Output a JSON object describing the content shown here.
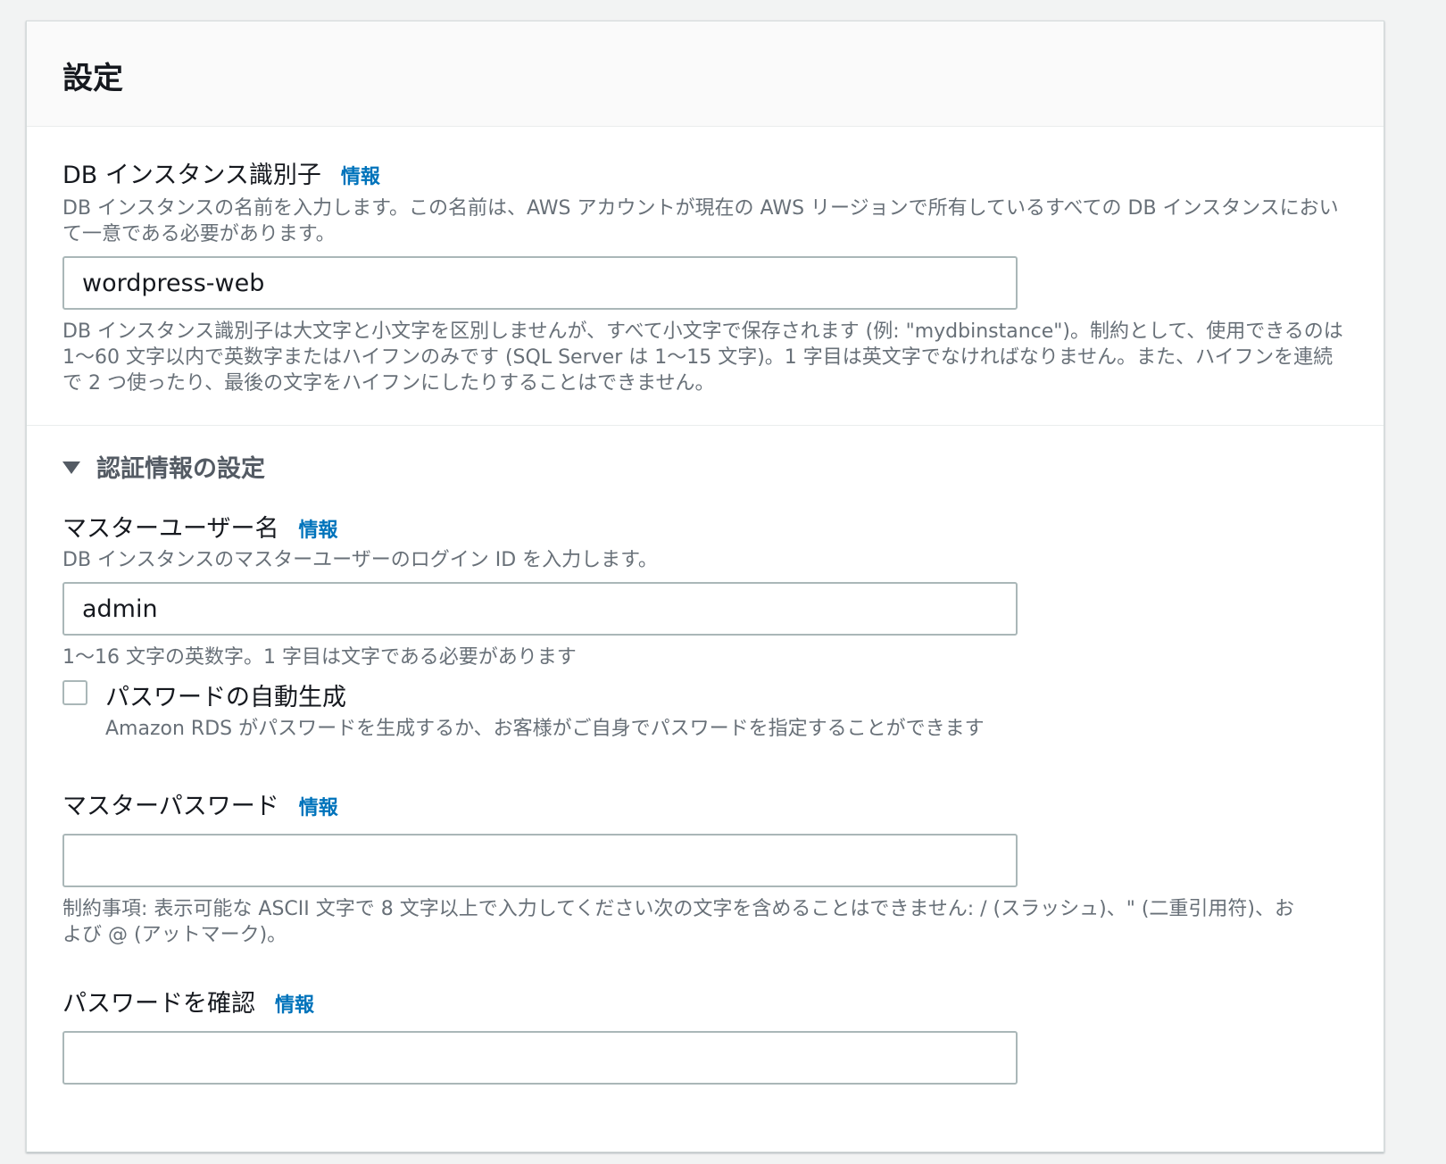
{
  "header": {
    "title": "設定"
  },
  "instance_identifier": {
    "label": "DB インスタンス識別子",
    "info": "情報",
    "description": "DB インスタンスの名前を入力します。この名前は、AWS アカウントが現在の AWS リージョンで所有しているすべての DB インスタンスにおいて一意である必要があります。",
    "value": "wordpress-web",
    "constraint": "DB インスタンス識別子は大文字と小文字を区別しませんが、すべて小文字で保存されます (例: \"mydbinstance\")。制約として、使用できるのは 1〜60 文字以内で英数字またはハイフンのみです (SQL Server は 1〜15 文字)。1 字目は英文字でなければなりません。また、ハイフンを連続で 2 つ使ったり、最後の文字をハイフンにしたりすることはできません。"
  },
  "credentials": {
    "section_label": "認証情報の設定",
    "master_username": {
      "label": "マスターユーザー名",
      "info": "情報",
      "description": "DB インスタンスのマスターユーザーのログイン ID を入力します。",
      "value": "admin",
      "constraint": "1〜16 文字の英数字。1 字目は文字である必要があります"
    },
    "auto_generate": {
      "label": "パスワードの自動生成",
      "description": "Amazon RDS がパスワードを生成するか、お客様がご自身でパスワードを指定することができます",
      "checked": false
    },
    "master_password": {
      "label": "マスターパスワード",
      "info": "情報",
      "value": "",
      "constraint": "制約事項: 表示可能な ASCII 文字で 8 文字以上で入力してください次の文字を含めることはできません: / (スラッシュ)、\" (二重引用符)、および @ (アットマーク)。"
    },
    "confirm_password": {
      "label": "パスワードを確認",
      "info": "情報",
      "value": ""
    }
  }
}
